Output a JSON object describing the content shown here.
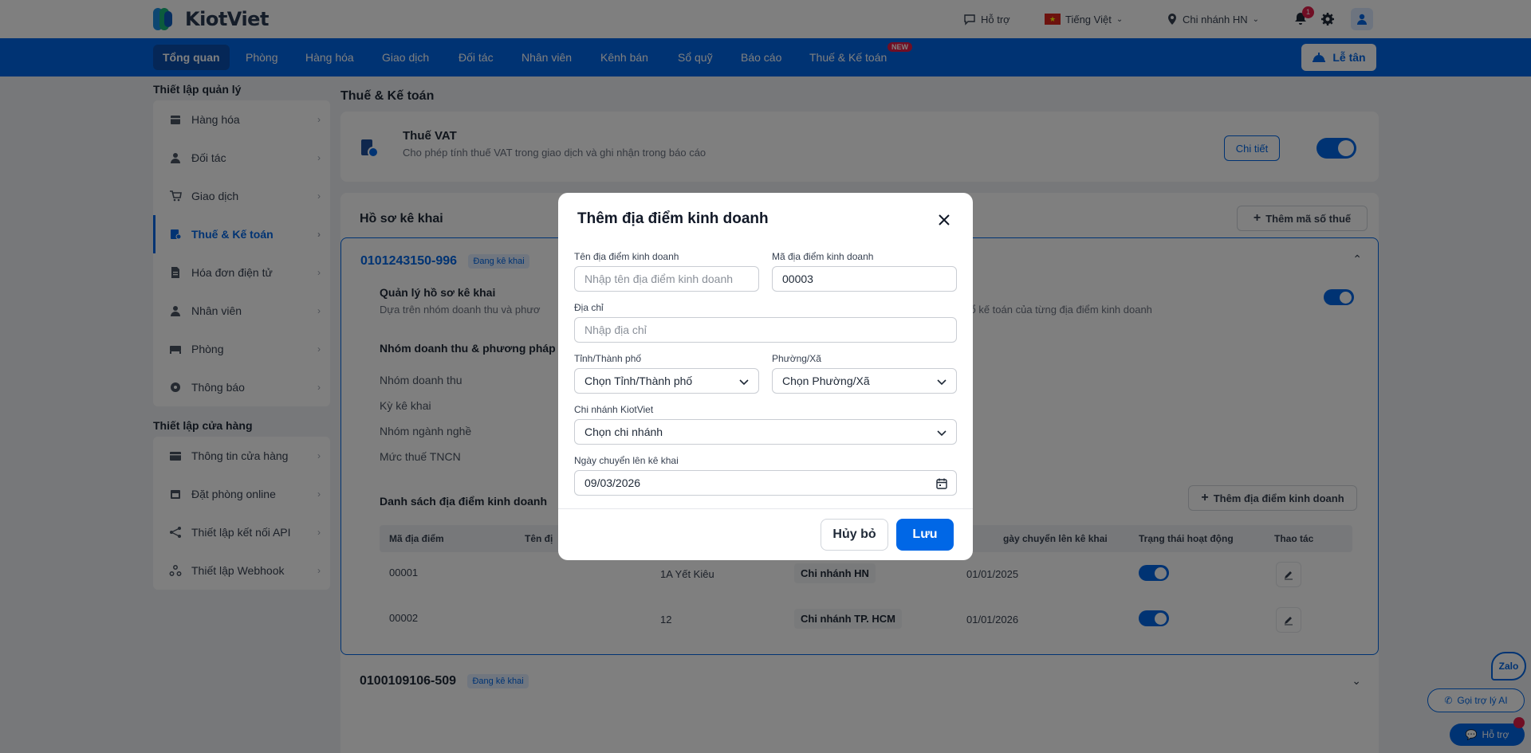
{
  "app": {
    "logo_text": "KiotViet",
    "brand_color": "#0067e6"
  },
  "topbar": {
    "support": "Hỗ trợ",
    "language": "Tiếng Việt",
    "branch": "Chi nhánh HN",
    "notification_count": "1"
  },
  "nav": {
    "items": [
      "Tổng quan",
      "Phòng",
      "Hàng hóa",
      "Giao dịch",
      "Đối tác",
      "Nhân viên",
      "Kênh bán",
      "Sổ quỹ",
      "Báo cáo",
      "Thuế & Kế toán"
    ],
    "new_badge": "NEW",
    "reception_button": "Lễ tân"
  },
  "sidebar": {
    "section1_title": "Thiết lập quản lý",
    "section1_items": [
      "Hàng hóa",
      "Đối tác",
      "Giao dịch",
      "Thuế & Kế toán",
      "Hóa đơn điện tử",
      "Nhân viên",
      "Phòng",
      "Thông báo"
    ],
    "section2_title": "Thiết lập cửa hàng",
    "section2_items": [
      "Thông tin cửa hàng",
      "Đặt phòng online",
      "Thiết lập kết nối API",
      "Thiết lập Webhook"
    ]
  },
  "main": {
    "title": "Thuế & Kế toán",
    "vat": {
      "title": "Thuế VAT",
      "desc": "Cho phép tính thuế VAT trong giao dịch và ghi nhận trong báo cáo",
      "detail_button": "Chi tiết"
    },
    "profile_header": "Hồ sơ kê khai",
    "add_tax_button": "Thêm mã số thuế",
    "profile1": {
      "tax_code": "0101243150-996",
      "status": "Đang kê khai",
      "manage_title": "Quản lý hồ sơ kê khai",
      "manage_desc_left": "Dựa trên nhóm doanh thu và phươ",
      "manage_desc_right": "sổ kế toán của từng địa điểm kinh doanh",
      "group_title": "Nhóm doanh thu & phương pháp t",
      "field_labels": [
        "Nhóm doanh thu",
        "Kỳ kê khai",
        "Nhóm ngành nghề",
        "Mức thuế TNCN"
      ],
      "locations_title": "Danh sách địa điểm kinh doanh",
      "add_location_button": "Thêm địa điểm kinh doanh",
      "table_headers": [
        "Mã địa điểm",
        "Tên đị",
        "gày chuyển lên kê khai",
        "Trạng thái hoạt động",
        "Thao tác"
      ],
      "rows": [
        {
          "code": "00001",
          "address": "1A Yết Kiêu",
          "branch": "Chi nhánh HN",
          "date": "01/01/2025"
        },
        {
          "code": "00002",
          "address": "12",
          "branch": "Chi nhánh TP. HCM",
          "date": "01/01/2026"
        }
      ]
    },
    "profile2": {
      "tax_code": "0100109106-509",
      "status": "Đang kê khai"
    }
  },
  "floating": {
    "zalo": "Zalo",
    "ai_support": "Gọi trợ lý AI",
    "help": "Hỗ trợ"
  },
  "modal": {
    "title": "Thêm địa điểm kinh doanh",
    "name_label": "Tên địa điểm kinh doanh",
    "name_placeholder": "Nhập tên địa điểm kinh doanh",
    "code_label": "Mã địa điểm kinh doanh",
    "code_value": "00003",
    "address_label": "Địa chỉ",
    "address_placeholder": "Nhập địa chỉ",
    "province_label": "Tỉnh/Thành phố",
    "province_value": "Chọn Tỉnh/Thành phố",
    "ward_label": "Phường/Xã",
    "ward_value": "Chọn Phường/Xã",
    "branch_label": "Chi nhánh KiotViet",
    "branch_value": "Chọn chi nhánh",
    "date_label": "Ngày chuyển lên kê khai",
    "date_value": "09/03/2026",
    "cancel_button": "Hủy bỏ",
    "save_button": "Lưu"
  }
}
